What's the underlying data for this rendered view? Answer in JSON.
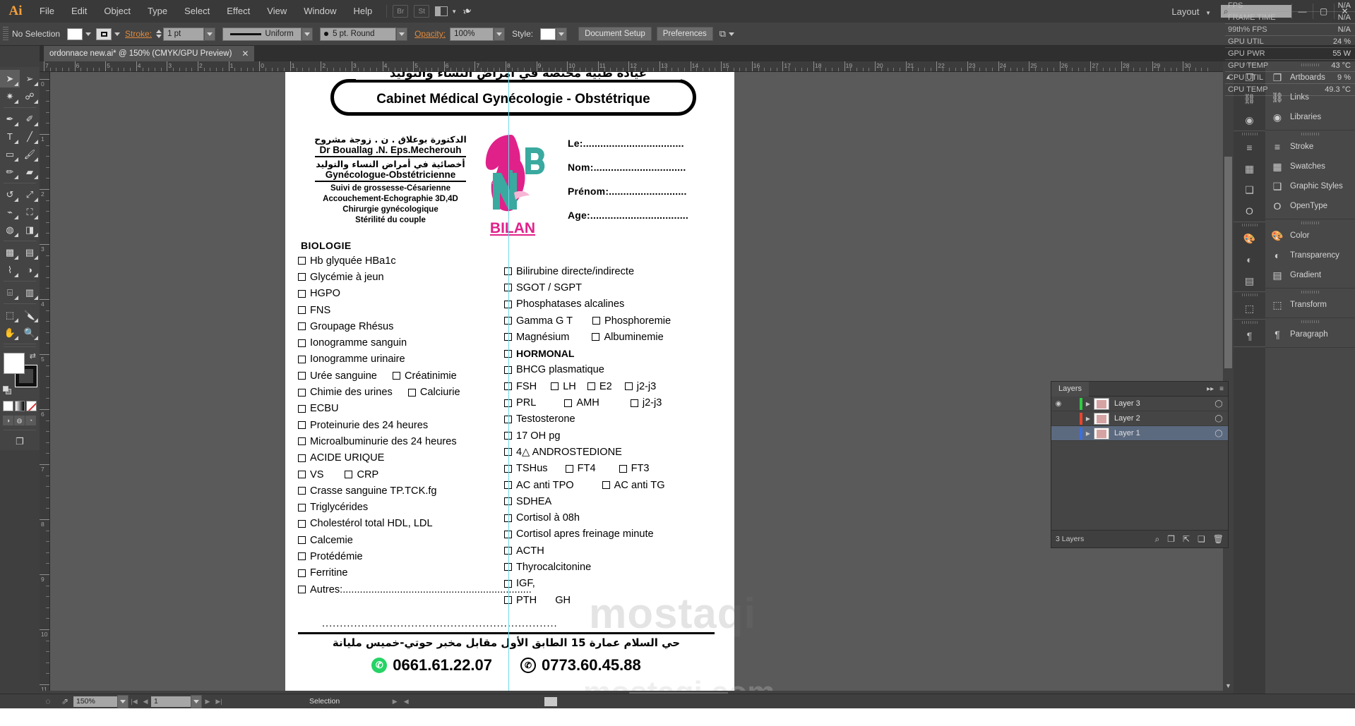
{
  "app": {
    "name": "Ai",
    "menus": [
      "File",
      "Edit",
      "Object",
      "Type",
      "Select",
      "Effect",
      "View",
      "Window",
      "Help"
    ],
    "bridge_label": "Br",
    "stock_label": "St",
    "arrange_label": "",
    "workspace_label": "Layout",
    "search_placeholder": ""
  },
  "window_controls": {
    "minimize": "—",
    "maximize": "▢",
    "close": "✕"
  },
  "control_bar": {
    "selection_state": "No Selection",
    "stroke_label": "Stroke:",
    "stroke_weight": "1 pt",
    "profile": "Uniform",
    "brush": "5 pt. Round",
    "opacity_label": "Opacity:",
    "opacity_value": "100%",
    "style_label": "Style:",
    "document_setup": "Document Setup",
    "preferences": "Preferences"
  },
  "tab": {
    "title": "ordonnace new.ai* @ 150% (CMYK/GPU Preview)",
    "close": "✕"
  },
  "rulers": {
    "horizontal": [
      "7",
      "6",
      "5",
      "4",
      "3",
      "2",
      "1",
      "0",
      "1",
      "2",
      "3",
      "4",
      "5",
      "6",
      "7",
      "8",
      "9",
      "10",
      "11",
      "12",
      "13",
      "14",
      "15",
      "16",
      "17",
      "18",
      "19",
      "20",
      "21",
      "22",
      "23",
      "24",
      "25",
      "26",
      "27",
      "28",
      "29",
      "30"
    ],
    "vertical": [
      "0",
      "1",
      "2",
      "3",
      "4",
      "5",
      "6",
      "7",
      "8",
      "9",
      "10",
      "11"
    ]
  },
  "tools": [
    {
      "name": "selection-tool",
      "glyph": "➤",
      "selected": true
    },
    {
      "name": "direct-selection-tool",
      "glyph": "➢",
      "selected": false
    },
    {
      "name": "magic-wand-tool",
      "glyph": "✷",
      "selected": false
    },
    {
      "name": "lasso-tool",
      "glyph": "☍",
      "selected": false
    },
    {
      "name": "pen-tool",
      "glyph": "✒",
      "selected": false
    },
    {
      "name": "curvature-tool",
      "glyph": "✐",
      "selected": false
    },
    {
      "name": "type-tool",
      "glyph": "T",
      "selected": false
    },
    {
      "name": "line-segment-tool",
      "glyph": "╱",
      "selected": false
    },
    {
      "name": "rectangle-tool",
      "glyph": "▭",
      "selected": false
    },
    {
      "name": "paintbrush-tool",
      "glyph": "🖌",
      "selected": false
    },
    {
      "name": "pencil-tool",
      "glyph": "✏",
      "selected": false
    },
    {
      "name": "eraser-tool",
      "glyph": "▰",
      "selected": false
    },
    {
      "name": "rotate-tool",
      "glyph": "↺",
      "selected": false
    },
    {
      "name": "scale-tool",
      "glyph": "⤢",
      "selected": false
    },
    {
      "name": "width-tool",
      "glyph": "⌁",
      "selected": false
    },
    {
      "name": "free-transform-tool",
      "glyph": "⛶",
      "selected": false
    },
    {
      "name": "shape-builder-tool",
      "glyph": "◍",
      "selected": false
    },
    {
      "name": "perspective-grid-tool",
      "glyph": "◨",
      "selected": false
    },
    {
      "name": "mesh-tool",
      "glyph": "▩",
      "selected": false
    },
    {
      "name": "gradient-tool",
      "glyph": "▤",
      "selected": false
    },
    {
      "name": "eyedropper-tool",
      "glyph": "⌇",
      "selected": false
    },
    {
      "name": "blend-tool",
      "glyph": "◑",
      "selected": false
    },
    {
      "name": "symbol-sprayer-tool",
      "glyph": "⌸",
      "selected": false
    },
    {
      "name": "column-graph-tool",
      "glyph": "▥",
      "selected": false
    },
    {
      "name": "artboard-tool",
      "glyph": "⬚",
      "selected": false
    },
    {
      "name": "slice-tool",
      "glyph": "🔪",
      "selected": false
    },
    {
      "name": "hand-tool",
      "glyph": "✋",
      "selected": false
    },
    {
      "name": "zoom-tool",
      "glyph": "🔍",
      "selected": false
    }
  ],
  "document": {
    "header_arabic": "عيادة طبية مختصة في أمراض النساء والتوليد",
    "header_french": "Cabinet Médical  Gynécologie - Obstétrique",
    "doctor": {
      "name_arabic": "الدكتورة بوعلاق . ن . زوجة مشروح",
      "name_french": "Dr Bouallag .N. Eps.Mecherouh",
      "speciality_arabic": "أخصائية في أمراض النساء والتوليد",
      "speciality_french": "Gynécologue-Obstétricienne",
      "services": [
        "Suivi de grossesse-Césarienne",
        "Accouchement-Echographie 3D,4D",
        "Chirurgie gynécologique",
        "Stérilité du couple"
      ]
    },
    "logo_title": "BILAN",
    "patient_fields": [
      "Le:...................................",
      "Nom:................................",
      "Prénom:...........................",
      "Age:.................................."
    ],
    "section_title": "BIOLOGIE",
    "left_column": [
      {
        "items": [
          {
            "label": "Hb glyquée HBa1c"
          }
        ]
      },
      {
        "items": [
          {
            "label": "Glycémie à jeun"
          }
        ]
      },
      {
        "items": [
          {
            "label": "HGPO"
          }
        ]
      },
      {
        "items": [
          {
            "label": "FNS"
          }
        ]
      },
      {
        "items": [
          {
            "label": "Groupage Rhésus"
          }
        ]
      },
      {
        "items": [
          {
            "label": "Ionogramme sanguin"
          }
        ]
      },
      {
        "items": [
          {
            "label": "Ionogramme urinaire"
          }
        ]
      },
      {
        "items": [
          {
            "label": "Urée sanguine"
          },
          {
            "label": "Créatinimie",
            "indent": 22
          }
        ]
      },
      {
        "items": [
          {
            "label": "Chimie des urines"
          },
          {
            "label": "Calciurie",
            "indent": 22
          }
        ]
      },
      {
        "items": [
          {
            "label": "ECBU"
          }
        ]
      },
      {
        "items": [
          {
            "label": "Proteinurie des 24 heures"
          }
        ]
      },
      {
        "items": [
          {
            "label": "Microalbuminurie des 24 heures"
          }
        ]
      },
      {
        "items": [
          {
            "label": "ACIDE URIQUE"
          }
        ]
      },
      {
        "items": [
          {
            "label": "VS"
          },
          {
            "label": "CRP",
            "indent": 30
          }
        ]
      },
      {
        "items": [
          {
            "label": "Crasse sanguine TP.TCK.fg"
          }
        ]
      },
      {
        "items": [
          {
            "label": "Triglycérides"
          }
        ]
      },
      {
        "items": [
          {
            "label": "Cholestérol total HDL, LDL"
          }
        ]
      },
      {
        "items": [
          {
            "label": "Calcemie"
          }
        ]
      },
      {
        "items": [
          {
            "label": "Protédémie"
          }
        ]
      },
      {
        "items": [
          {
            "label": "Ferritine"
          }
        ]
      },
      {
        "items": [
          {
            "label": "Autres:.................................................................."
          }
        ]
      }
    ],
    "left_continuation": "..................................................................",
    "right_column": [
      {
        "items": [
          {
            "label": "Bilirubine directe/indirecte"
          }
        ]
      },
      {
        "items": [
          {
            "label": "SGOT / SGPT"
          }
        ]
      },
      {
        "items": [
          {
            "label": "Phosphatases alcalines"
          }
        ]
      },
      {
        "items": [
          {
            "label": "Gamma G T"
          },
          {
            "label": "Phosphoremie",
            "indent": 28
          }
        ]
      },
      {
        "items": [
          {
            "label": "Magnésium"
          },
          {
            "label": "Albuminemie",
            "indent": 32
          }
        ]
      },
      {
        "items": [
          {
            "label": "HORMONAL",
            "bold": true
          }
        ]
      },
      {
        "items": [
          {
            "label": "BHCG plasmatique"
          }
        ]
      },
      {
        "items": [
          {
            "label": "FSH"
          },
          {
            "label": "LH",
            "indent": 20
          },
          {
            "label": "E2",
            "indent": 16
          },
          {
            "label": "j2-j3",
            "indent": 18
          }
        ]
      },
      {
        "items": [
          {
            "label": "PRL"
          },
          {
            "label": "AMH",
            "indent": 40
          },
          {
            "label": "j2-j3",
            "indent": 44
          }
        ]
      },
      {
        "items": [
          {
            "label": "Testosterone"
          }
        ]
      },
      {
        "items": [
          {
            "label": "17 OH pg"
          }
        ]
      },
      {
        "items": [
          {
            "label": "4△  ANDROSTEDIONE"
          }
        ]
      },
      {
        "items": [
          {
            "label": "TSHus"
          },
          {
            "label": "FT4",
            "indent": 25
          },
          {
            "label": "FT3",
            "indent": 33
          }
        ]
      },
      {
        "items": [
          {
            "label": "AC anti TPO"
          },
          {
            "label": "AC anti TG",
            "indent": 40
          }
        ]
      },
      {
        "items": [
          {
            "label": "SDHEA"
          }
        ]
      },
      {
        "items": [
          {
            "label": "Cortisol à 08h"
          }
        ]
      },
      {
        "items": [
          {
            "label": "Cortisol apres freinage minute"
          }
        ]
      },
      {
        "items": [
          {
            "label": "ACTH"
          }
        ]
      },
      {
        "items": [
          {
            "label": "Thyrocalcitonine"
          }
        ]
      },
      {
        "items": [
          {
            "label": "IGF,"
          }
        ]
      },
      {
        "items": [
          {
            "label": "PTH"
          },
          {
            "label": "GH",
            "indent": 26,
            "nobox": true
          }
        ]
      }
    ],
    "footer_address": "حي السلام عمارة 15 الطابق الأول مقابل مخبر حوتي-خميس مليانة",
    "phone_whatsapp": "0661.61.22.07",
    "phone_fixed": "0773.60.45.88",
    "watermark": "mostaqi",
    "watermark2": "mostaqi.com",
    "colors": {
      "pink": "#e0218a",
      "teal": "#3aa99f"
    }
  },
  "fps_overlay": [
    {
      "label": "FPS",
      "value": "N/A"
    },
    {
      "label": "FRAME TIME",
      "value": "N/A"
    },
    {
      "label": "99th% FPS",
      "value": "N/A"
    },
    {
      "label": "GPU UTIL",
      "value": "24 %"
    },
    {
      "label": "GPU PWR",
      "value": "55 W"
    },
    {
      "label": "GPU TEMP",
      "value": "43 °C"
    },
    {
      "label": "CPU UTIL",
      "value": "9 %"
    },
    {
      "label": "CPU TEMP",
      "value": "49.3 °C"
    }
  ],
  "right_dock": [
    {
      "group": [
        {
          "label": "Artboards",
          "icon": "artboards-icon",
          "glyph": "❐"
        },
        {
          "label": "Links",
          "icon": "links-icon",
          "glyph": "⛓"
        },
        {
          "label": "Libraries",
          "icon": "libraries-icon",
          "glyph": "◉"
        }
      ]
    },
    {
      "group": [
        {
          "label": "Stroke",
          "icon": "stroke-icon",
          "glyph": "≡"
        },
        {
          "label": "Swatches",
          "icon": "swatches-icon",
          "glyph": "▦"
        },
        {
          "label": "Graphic Styles",
          "icon": "graphic-styles-icon",
          "glyph": "❑"
        },
        {
          "label": "OpenType",
          "icon": "opentype-icon",
          "glyph": "O"
        }
      ]
    },
    {
      "group": [
        {
          "label": "Color",
          "icon": "color-icon",
          "glyph": "🎨"
        },
        {
          "label": "Transparency",
          "icon": "transparency-icon",
          "glyph": "◐"
        },
        {
          "label": "Gradient",
          "icon": "gradient-icon",
          "glyph": "▤"
        }
      ]
    },
    {
      "group": [
        {
          "label": "Transform",
          "icon": "transform-icon",
          "glyph": "⬚"
        }
      ]
    },
    {
      "group": [
        {
          "label": "Paragraph",
          "icon": "paragraph-icon",
          "glyph": "¶"
        }
      ]
    }
  ],
  "layers_panel": {
    "title": "Layers",
    "rows": [
      {
        "name": "Layer 3",
        "color": "#2ecc40",
        "selected": false
      },
      {
        "name": "Layer 2",
        "color": "#e8442e",
        "selected": false
      },
      {
        "name": "Layer 1",
        "color": "#3d6fe0",
        "selected": true
      }
    ],
    "count_label": "3 Layers",
    "footer_icons": [
      "locate-object-icon",
      "make-clipping-mask-icon",
      "create-sublayer-icon",
      "new-layer-icon",
      "delete-layer-icon"
    ]
  },
  "status_bar": {
    "zoom": "150%",
    "artboard_number": "1",
    "tool_status": "Selection"
  }
}
